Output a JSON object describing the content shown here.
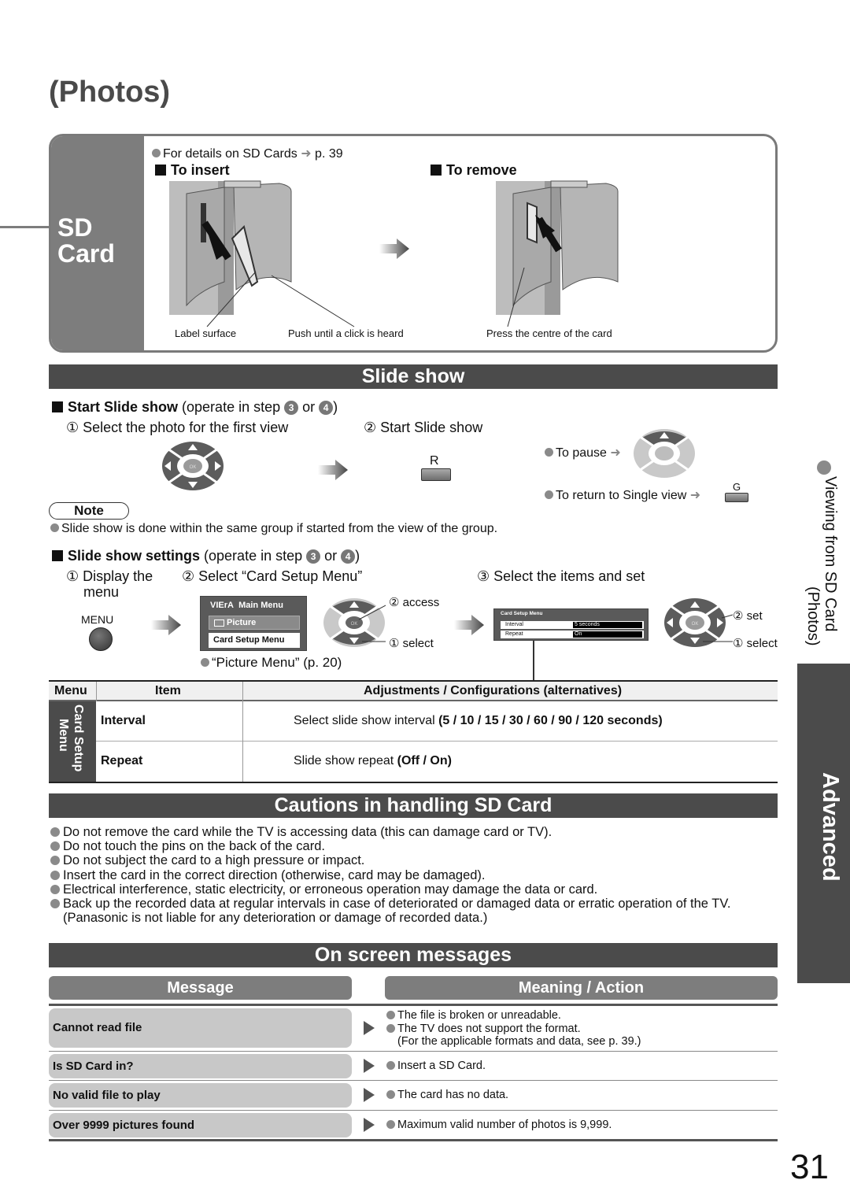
{
  "page": {
    "title": "(Photos)",
    "number": "31"
  },
  "side": {
    "section_title_line1": "Viewing from SD Card",
    "section_title_line2": "(Photos)",
    "tab_label": "Advanced"
  },
  "sd_card": {
    "side_label_line1": "SD",
    "side_label_line2": "Card",
    "details_text": "For details on SD Cards",
    "details_ref": "p. 39",
    "insert_heading": "To insert",
    "remove_heading": "To remove",
    "captions": {
      "label_surface": "Label surface",
      "push_click": "Push until a click is heard",
      "press_centre": "Press the centre of the card"
    }
  },
  "slide_show": {
    "bar_title": "Slide show",
    "start": {
      "heading_bold": "Start Slide show",
      "heading_rest": " (operate in step ",
      "step_a": "3",
      "or": " or ",
      "step_b": "4",
      "close": ")",
      "step1": "① Select the photo for the first view",
      "step2": "② Start Slide show",
      "key_r": "R",
      "pause_label": "To pause",
      "return_label": "To return to Single view",
      "key_g": "G",
      "ok_label": "OK"
    },
    "note": {
      "label": "Note",
      "text": "Slide show is done within the same group if started from the view of the group."
    },
    "settings": {
      "heading_bold": "Slide show settings",
      "heading_rest": " (operate in step ",
      "step_a": "3",
      "or": " or ",
      "step_b": "4",
      "close": ")",
      "step1_line1": "① Display the",
      "step1_line2": "menu",
      "step2": "② Select “Card Setup Menu”",
      "step3": "③ Select the items and set",
      "menu_key": "MENU",
      "access_label": "② access",
      "select_label": "① select",
      "set_label": "② set",
      "select_label2": "① select",
      "picture_menu_ref": "“Picture Menu” (p. 20)",
      "osd_main": {
        "brand": "VIErA",
        "title": "Main Menu",
        "item_picture": "Picture",
        "item_card_setup": "Card Setup Menu"
      },
      "osd_card": {
        "title": "Card Setup Menu",
        "rows": [
          {
            "label": "Interval",
            "value": "5 seconds"
          },
          {
            "label": "Repeat",
            "value": "On"
          }
        ]
      }
    },
    "table": {
      "headers": [
        "Menu",
        "Item",
        "Adjustments / Configurations (alternatives)"
      ],
      "menu_group_line1": "Card Setup",
      "menu_group_line2": "Menu",
      "rows": [
        {
          "item": "Interval",
          "desc": "Select slide show interval ",
          "options": "(5 / 10 / 15 / 30 / 60 / 90 / 120 seconds)"
        },
        {
          "item": "Repeat",
          "desc": "Slide show repeat ",
          "options": "(Off / On)"
        }
      ]
    }
  },
  "cautions": {
    "bar_title": "Cautions in handling SD Card",
    "items": [
      "Do not remove the card while the TV is accessing data (this can damage card or TV).",
      "Do not touch the pins on the back of the card.",
      "Do not subject the card to a high pressure or impact.",
      "Insert the card in the correct direction (otherwise, card may be damaged).",
      "Electrical interference, static electricity, or erroneous operation may damage the data or card.",
      "Back up the recorded data at regular intervals in case of deteriorated or damaged data or erratic operation of the TV. (Panasonic is not liable for any deterioration or damage of recorded data.)"
    ]
  },
  "messages": {
    "bar_title": "On screen messages",
    "col_message": "Message",
    "col_meaning": "Meaning / Action",
    "rows": [
      {
        "message": "Cannot read file",
        "meanings": [
          "The file is broken or unreadable.",
          "The TV does not support the format."
        ],
        "extra": "(For the applicable formats and data, see p. 39.)"
      },
      {
        "message": "Is SD Card in?",
        "meanings": [
          "Insert a SD Card."
        ]
      },
      {
        "message": "No valid file to play",
        "meanings": [
          "The card has no data."
        ]
      },
      {
        "message": "Over 9999 pictures found",
        "meanings": [
          "Maximum valid number of photos is 9,999."
        ]
      }
    ]
  }
}
